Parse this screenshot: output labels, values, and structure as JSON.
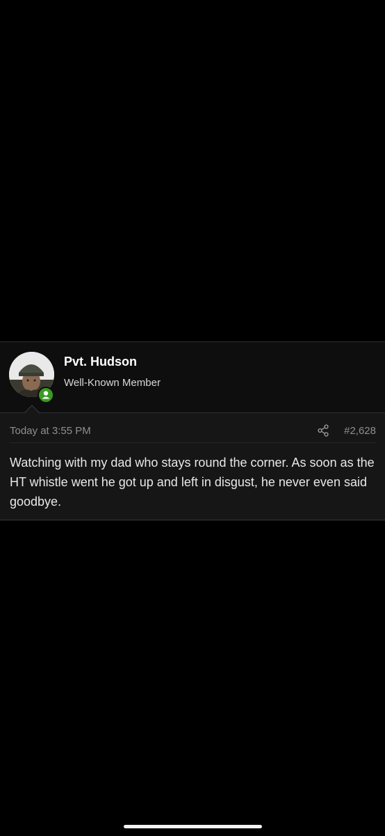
{
  "post": {
    "user": {
      "name": "Pvt. Hudson",
      "title": "Well-Known Member",
      "online": true
    },
    "meta": {
      "time": "Today at 3:55 PM",
      "number": "#2,628"
    },
    "body": "Watching with my dad who stays round the corner. As soon as the HT whistle went he got up and left in disgust, he never even said goodbye."
  },
  "icons": {
    "avatar": "avatar-image",
    "online": "user-online-icon",
    "share": "share-icon"
  },
  "colors": {
    "background": "#000000",
    "card": "#161616",
    "user_block": "#0e0e0e",
    "online": "#3a9a22",
    "muted_text": "#8f8f8f"
  }
}
